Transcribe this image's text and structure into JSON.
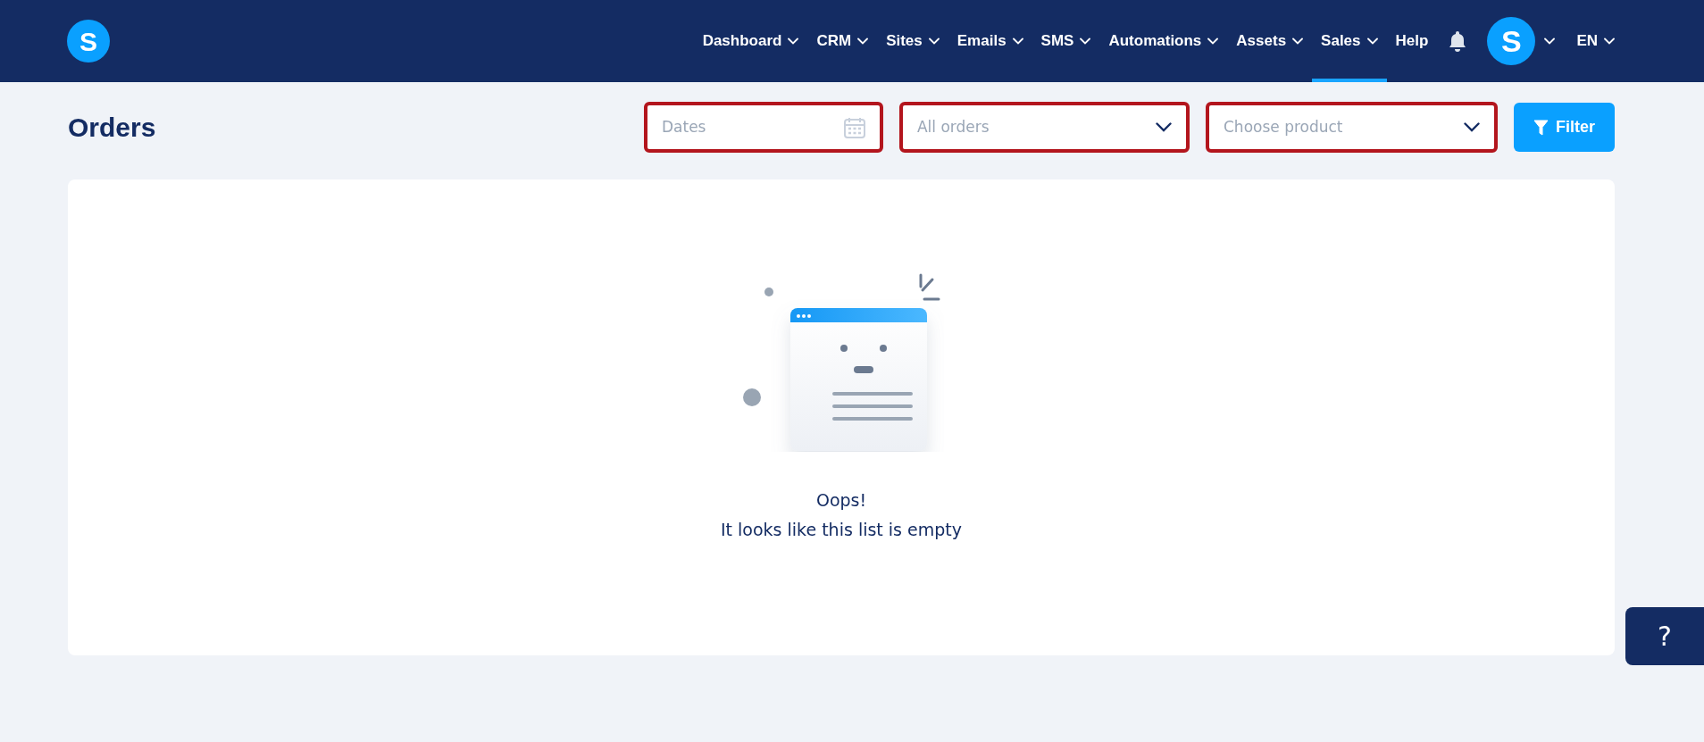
{
  "logo": {
    "letter": "S"
  },
  "nav": [
    {
      "label": "Dashboard",
      "dropdown": true,
      "selected": false
    },
    {
      "label": "CRM",
      "dropdown": true,
      "selected": false
    },
    {
      "label": "Sites",
      "dropdown": true,
      "selected": false
    },
    {
      "label": "Emails",
      "dropdown": true,
      "selected": false
    },
    {
      "label": "SMS",
      "dropdown": true,
      "selected": false
    },
    {
      "label": "Automations",
      "dropdown": true,
      "selected": false
    },
    {
      "label": "Assets",
      "dropdown": true,
      "selected": false
    },
    {
      "label": "Sales",
      "dropdown": true,
      "selected": true
    },
    {
      "label": "Help",
      "dropdown": false,
      "selected": false
    }
  ],
  "avatar": {
    "letter": "S"
  },
  "language": {
    "label": "EN"
  },
  "page_title": "Orders",
  "filters": [
    {
      "kind": "date",
      "placeholder": "Dates",
      "highlighted": true
    },
    {
      "kind": "select",
      "placeholder": "All orders",
      "highlighted": true
    },
    {
      "kind": "select",
      "placeholder": "Choose product",
      "highlighted": true
    }
  ],
  "filter_button": "Filter",
  "empty_state": {
    "title": "Oops!",
    "message": "It looks like this list is empty"
  },
  "help_button": "?"
}
